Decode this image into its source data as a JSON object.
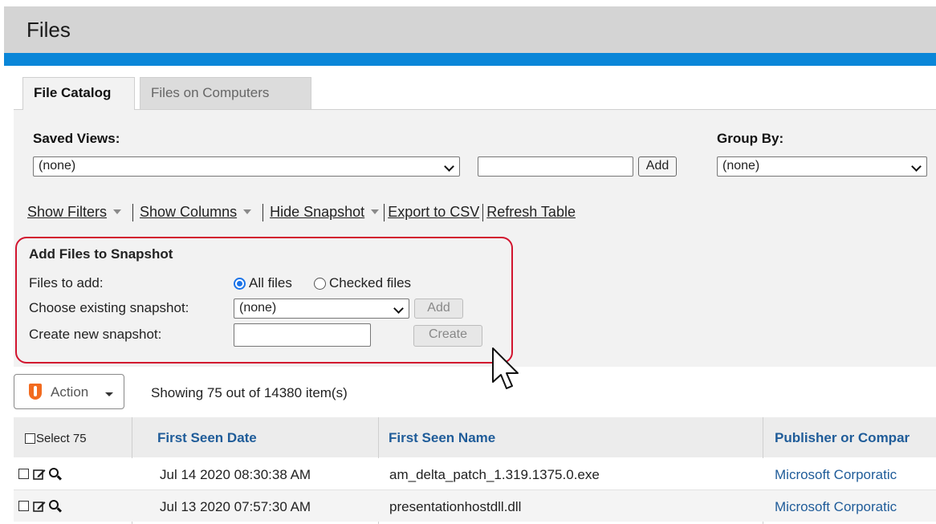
{
  "header": {
    "title": "Files"
  },
  "tabs": [
    {
      "label": "File Catalog",
      "active": true
    },
    {
      "label": "Files on Computers",
      "active": false
    }
  ],
  "filters": {
    "saved_views_label": "Saved Views:",
    "saved_views_value": "(none)",
    "new_view_value": "",
    "add_label": "Add",
    "group_by_label": "Group By:",
    "group_by_value": "(none)"
  },
  "links": {
    "show_filters": "Show Filters",
    "show_columns": "Show Columns",
    "hide_snapshot": "Hide Snapshot",
    "export_csv": "Export to CSV",
    "refresh_table": "Refresh Table"
  },
  "snapshot": {
    "heading": "Add Files to Snapshot",
    "files_to_add_label": "Files to add:",
    "option_all": "All files",
    "option_checked": "Checked files",
    "selected_option": "All files",
    "choose_existing_label": "Choose existing snapshot:",
    "existing_value": "(none)",
    "add_label": "Add",
    "create_new_label": "Create new snapshot:",
    "create_label": "Create",
    "highlight_color": "#d2152f"
  },
  "toolbar": {
    "action_label": "Action",
    "showing_text": "Showing 75 out of 14380 item(s)"
  },
  "table": {
    "select_label": "Select 75",
    "columns": [
      "First Seen Date",
      "First Seen Name",
      "Publisher or Compar"
    ],
    "rows": [
      {
        "date": "Jul 14 2020 08:30:38 AM",
        "name": "am_delta_patch_1.319.1375.0.exe",
        "publisher": "Microsoft Corporatic"
      },
      {
        "date": "Jul 13 2020 07:57:30 AM",
        "name": "presentationhostdll.dll",
        "publisher": "Microsoft Corporatic"
      }
    ]
  },
  "colors": {
    "accent": "#0a86d8",
    "link": "#1f5c99",
    "brand_orange": "#f26b1f"
  }
}
